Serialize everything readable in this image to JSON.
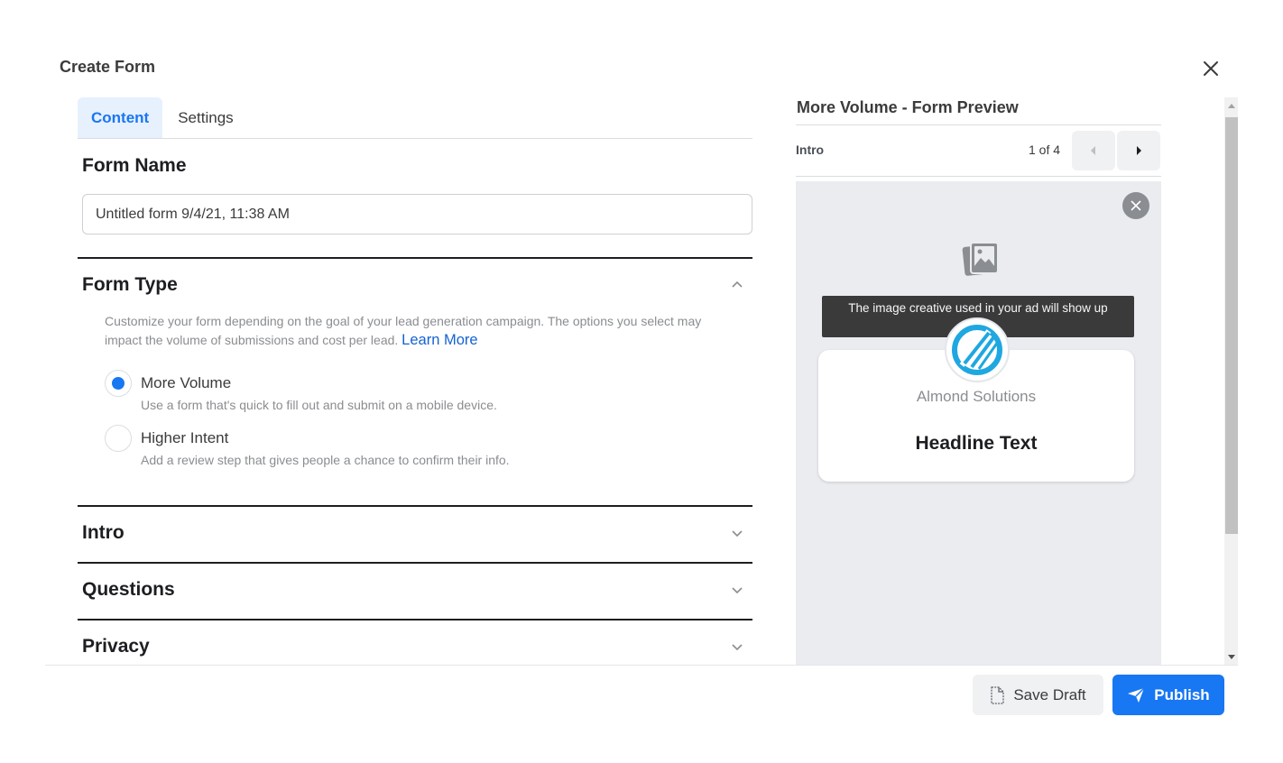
{
  "dialog": {
    "title": "Create Form",
    "close_icon": "close-icon"
  },
  "tabs": [
    {
      "label": "Content",
      "active": true
    },
    {
      "label": "Settings",
      "active": false
    }
  ],
  "form_name": {
    "title": "Form Name",
    "value": "Untitled form 9/4/21, 11:38 AM"
  },
  "form_type": {
    "title": "Form Type",
    "expanded": true,
    "description": "Customize your form depending on the goal of your lead generation campaign. The options you select may impact the volume of submissions and cost per lead.",
    "learn_more": "Learn More",
    "options": [
      {
        "label": "More Volume",
        "description": "Use a form that's quick to fill out and submit on a mobile device.",
        "selected": true
      },
      {
        "label": "Higher Intent",
        "description": "Add a review step that gives people a chance to confirm their info.",
        "selected": false
      }
    ]
  },
  "sections": [
    {
      "title": "Intro",
      "expanded": false
    },
    {
      "title": "Questions",
      "expanded": false
    },
    {
      "title": "Privacy",
      "expanded": false
    }
  ],
  "preview": {
    "title": "More Volume - Form Preview",
    "step_name": "Intro",
    "page_indicator": "1 of 4",
    "image_banner": "The image creative used in your ad will show up",
    "brand_name": "Almond Solutions",
    "headline": "Headline Text"
  },
  "footer": {
    "save_draft_label": "Save Draft",
    "publish_label": "Publish"
  },
  "colors": {
    "accent": "#1877f2",
    "tab_active_bg": "#e7f0fd",
    "preview_bg": "#ebecf0",
    "banner_bg": "#3a3a3b",
    "logo_blue": "#1fa7e1"
  }
}
